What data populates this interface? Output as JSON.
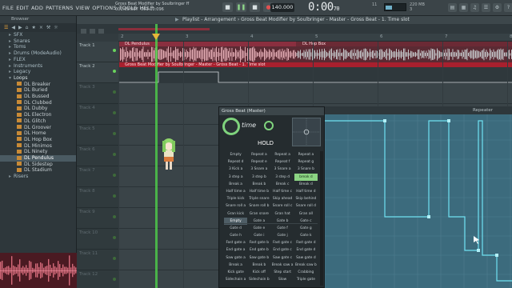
{
  "menu": [
    "FILE",
    "EDIT",
    "ADD",
    "PATTERNS",
    "VIEW",
    "OPTIONS",
    "TOOLS",
    "HELP"
  ],
  "song": {
    "title": "Gross Beat Modifier by Soulbringer ff",
    "pos_a": "001:03:087",
    "pos_b": "001:10:096"
  },
  "transport": {
    "bpm": "140.000",
    "time": "0:00",
    "time_fraction": "70",
    "cpu": "11",
    "ram": "220 MB",
    "voices": "3"
  },
  "browser": {
    "title": "Browser",
    "tools": [
      "☰",
      "◀",
      "▶",
      "⌂",
      "★",
      "×",
      "⚒",
      "☼"
    ],
    "items": [
      {
        "label": "SFX",
        "kind": "folder"
      },
      {
        "label": "Snares",
        "kind": "folder"
      },
      {
        "label": "Toms",
        "kind": "folder"
      },
      {
        "label": "Drums (ModeAudio)",
        "kind": "folder"
      },
      {
        "label": "FLEX",
        "kind": "folder"
      },
      {
        "label": "Instruments",
        "kind": "folder"
      },
      {
        "label": "Legacy",
        "kind": "folder"
      },
      {
        "label": "Loops",
        "kind": "open"
      },
      {
        "label": "DL Breaker",
        "kind": "file"
      },
      {
        "label": "DL Buried",
        "kind": "file"
      },
      {
        "label": "DL Bussed",
        "kind": "file"
      },
      {
        "label": "DL Clubbed",
        "kind": "file"
      },
      {
        "label": "DL Dubby",
        "kind": "file"
      },
      {
        "label": "DL Electron",
        "kind": "file"
      },
      {
        "label": "DL Glitch",
        "kind": "file"
      },
      {
        "label": "DL Groover",
        "kind": "file"
      },
      {
        "label": "DL Home",
        "kind": "file"
      },
      {
        "label": "DL Hop Box",
        "kind": "file"
      },
      {
        "label": "DL Minimos",
        "kind": "file"
      },
      {
        "label": "DL Ninety",
        "kind": "file"
      },
      {
        "label": "DL Pendulus",
        "kind": "selected"
      },
      {
        "label": "DL Sidestep",
        "kind": "file"
      },
      {
        "label": "DL Stadium",
        "kind": "file"
      },
      {
        "label": "Risers",
        "kind": "folder"
      }
    ]
  },
  "playlist": {
    "title": "Playlist - Arrangement › Gross Beat Modifier by Soulbringer - Master - Gross Beat - 1. Time slot",
    "ruler": [
      "2",
      "3",
      "4",
      "5",
      "6",
      "7",
      "8"
    ],
    "tracks": [
      {
        "label": "Track 1",
        "dim": false
      },
      {
        "label": "Track 2",
        "dim": false
      },
      {
        "label": "Track 3",
        "dim": true
      },
      {
        "label": "Track 4",
        "dim": true
      },
      {
        "label": "Track 5",
        "dim": true
      },
      {
        "label": "Track 6",
        "dim": true
      },
      {
        "label": "Track 7",
        "dim": true
      },
      {
        "label": "Track 8",
        "dim": true
      },
      {
        "label": "Track 9",
        "dim": true
      },
      {
        "label": "Track 10",
        "dim": true
      },
      {
        "label": "Track 11",
        "dim": true
      },
      {
        "label": "Track 12",
        "dim": true
      }
    ],
    "clip1_a": "DL Pendulus",
    "clip1_b": "DL Hop Box",
    "clip2": "Gross Beat Modifier by Soulbringer - Master - Gross Beat - 1. Time slot"
  },
  "grossbeat": {
    "title": "Gross Beat (Master)",
    "mode": "time",
    "hold": "HOLD",
    "repeater_label": "Repeater",
    "presets": [
      [
        "Empty",
        "Repeat a",
        "Repeat a"
      ],
      [
        "Repeat d",
        "Repeat e",
        "Repeat f"
      ],
      [
        "3 Kick a",
        "3 Snare a",
        "3 Snare a"
      ],
      [
        "3 step a",
        "3 step b",
        "3 step d"
      ],
      [
        "Break a",
        "Break b",
        "Break c"
      ],
      [
        "Half time a",
        "Half time b",
        "Half time c"
      ],
      [
        "Triple kick",
        "Triple snare",
        "Skip ahead"
      ],
      [
        "Snare roll a",
        "Snare roll b",
        "Snare roll c"
      ],
      [
        "Gran kick",
        "Gran snare",
        "Gran hat"
      ],
      [
        "Empty",
        "Gate a",
        "Gate b"
      ],
      [
        "Gate d",
        "Gate e",
        "Gate f"
      ],
      [
        "Gate h",
        "Gate i",
        "Gate j"
      ],
      [
        "Fast gate a",
        "Fast gate b",
        "Fast gate c"
      ],
      [
        "End gate a",
        "End gate b",
        "End gate c"
      ],
      [
        "Saw gate a",
        "Saw gate b",
        "Saw gate c"
      ],
      [
        "Break a",
        "Break b",
        "Break saw a"
      ],
      [
        "Kick gate",
        "Kick off",
        "Step start"
      ],
      [
        "Sidechain a",
        "Sidechain b",
        "Slow"
      ]
    ],
    "presets_right": [
      "Repeat a",
      "Repeat g",
      "3 Snare b",
      "break d",
      "Break d",
      "Half time d",
      "Skip behind",
      "Snare roll d",
      "Gran all",
      "Gate c",
      "Gate g",
      "Gate k",
      "Fast gate d",
      "End gate d",
      "Saw gate d",
      "Break saw b",
      "Crabbing",
      "Triple gate"
    ]
  }
}
